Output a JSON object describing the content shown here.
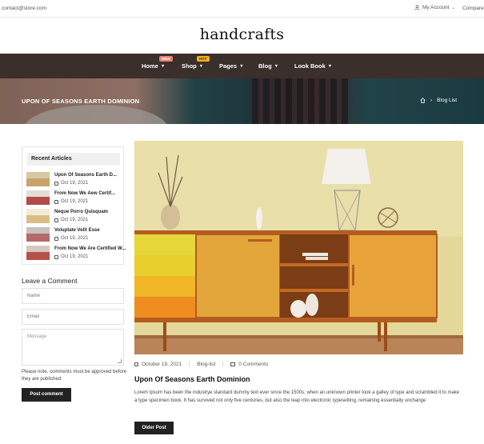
{
  "topbar": {
    "email": "contact@store.com",
    "account_label": "My Account",
    "account_icon": "user-icon",
    "compare_label": "Compare"
  },
  "site": {
    "logo": "handcrafts"
  },
  "nav": {
    "items": [
      {
        "label": "Home",
        "badge": "NEW"
      },
      {
        "label": "Shop",
        "badge": "HOT"
      },
      {
        "label": "Pages"
      },
      {
        "label": "Blog"
      },
      {
        "label": "Look Book"
      }
    ]
  },
  "banner": {
    "title": "UPON OF SEASONS EARTH DOMINION",
    "breadcrumb": {
      "home_icon": "home-icon",
      "current": "Blog List"
    }
  },
  "sidebar": {
    "recent_title": "Recent Articles",
    "articles": [
      {
        "title": "Upon Of Seasons Earth D...",
        "date": "Oct 19, 2021",
        "thumb_color": "#c9a46a"
      },
      {
        "title": "From Now We Aew Certif...",
        "date": "Oct 19, 2021",
        "thumb_color": "#b24a48"
      },
      {
        "title": "Neque Porro Quisquam",
        "date": "Oct 19, 2021",
        "thumb_color": "#d9bf86"
      },
      {
        "title": "Voluptate Velit Esse",
        "date": "Oct 19, 2021",
        "thumb_color": "#b56a6a"
      },
      {
        "title": "From Now We Are Certified W...",
        "date": "Oct 19, 2021",
        "thumb_color": "#b8504a"
      }
    ],
    "comment": {
      "heading": "Leave a Comment",
      "name_placeholder": "Name",
      "email_placeholder": "Email",
      "message_placeholder": "Message",
      "note": "Please note, comments must be approved before they are published",
      "submit_label": "Post comment"
    }
  },
  "post": {
    "date": "October 19, 2021",
    "category": "Blog-list",
    "comments": "0 Comments",
    "title": "Upon Of Seasons Earth Dominion",
    "excerpt": "Lorem Ipsum has been the industrye standard dummy text ever since the 1500s, when an unknown printer took a galley of type and scrambled it to make a type specimen book. It has survived not only five centuries, but also the leap into electronic typesetting, remaining essentially unchange",
    "older_label": "Older Post"
  }
}
